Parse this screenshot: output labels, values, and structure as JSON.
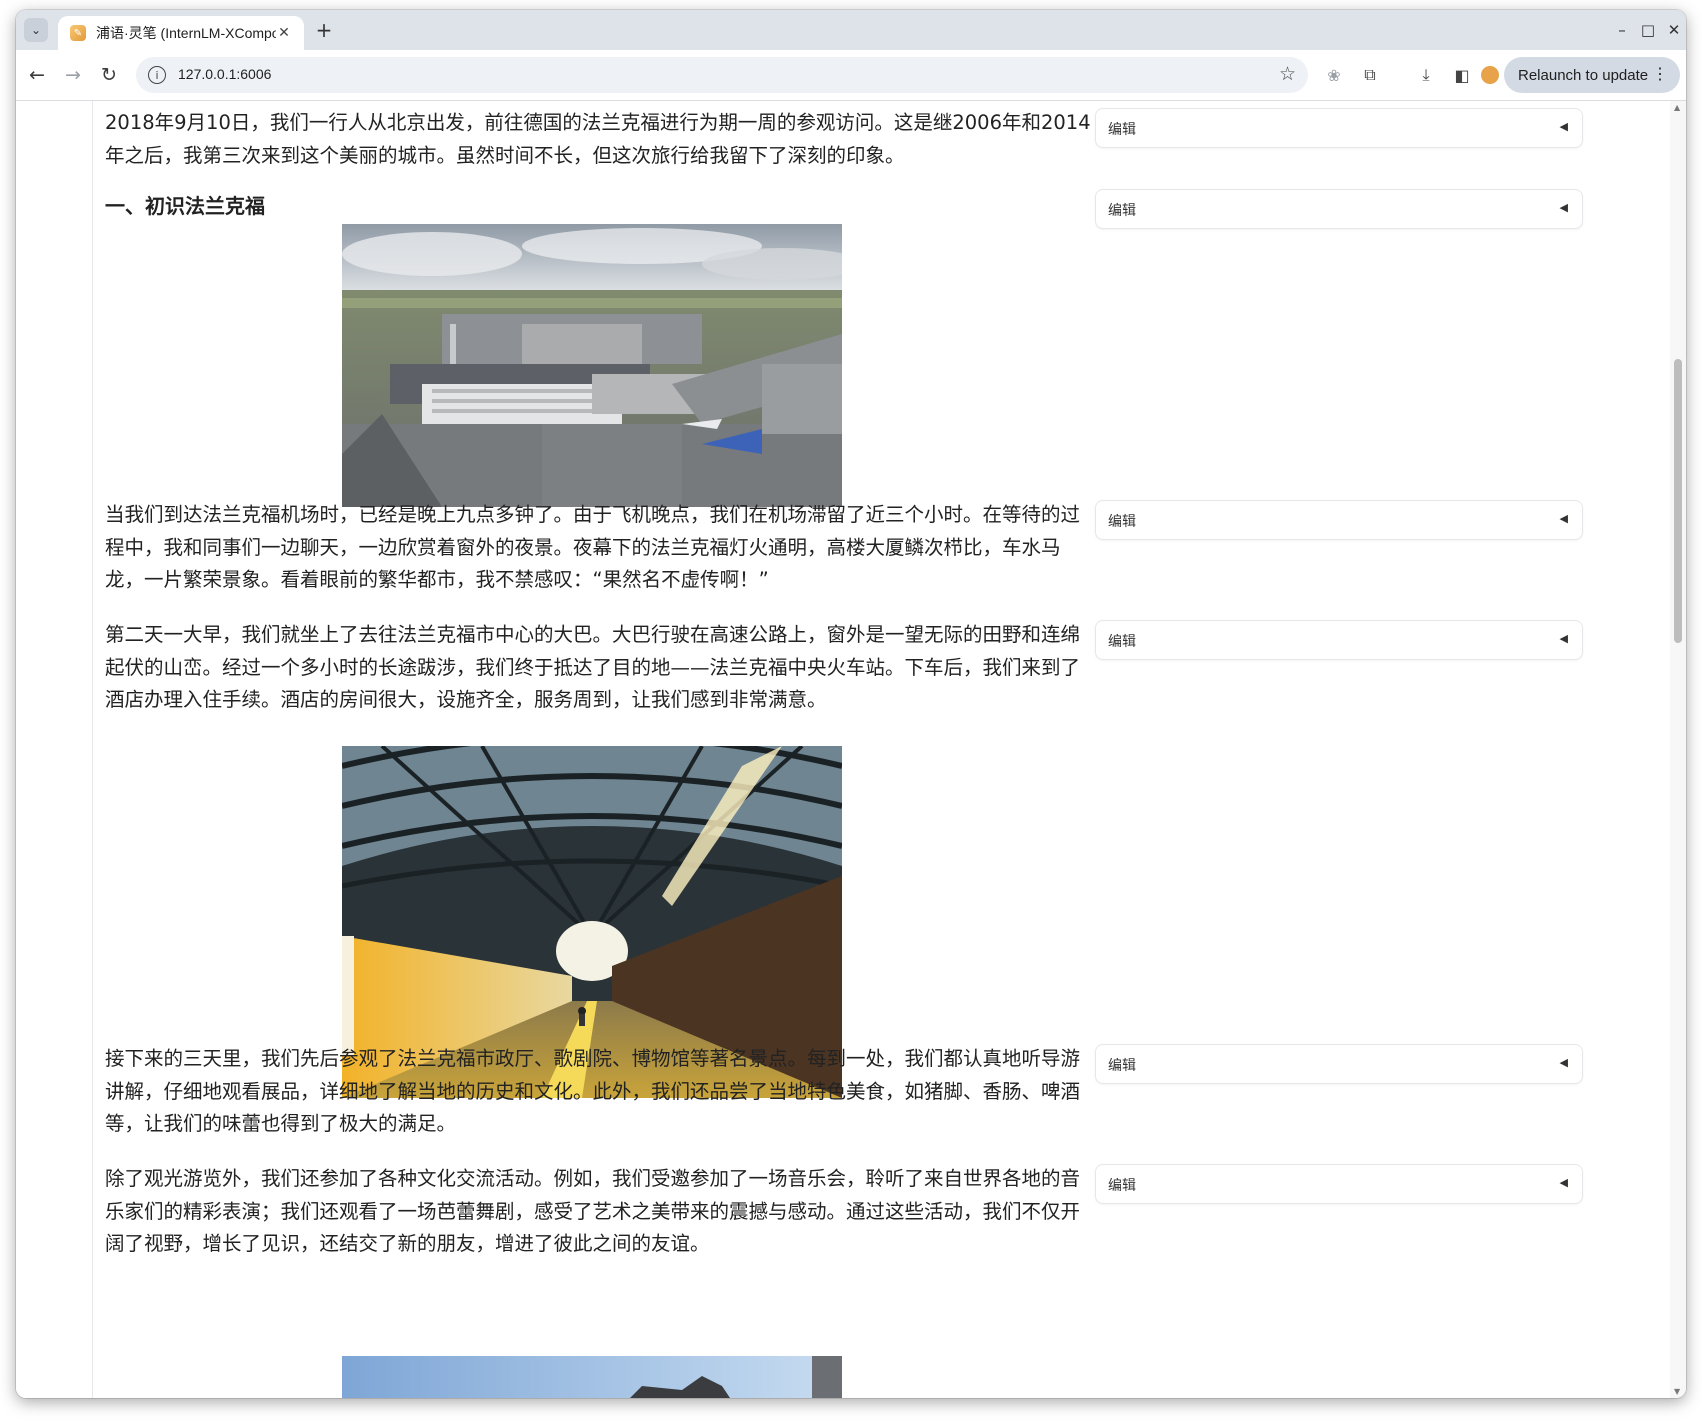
{
  "browser": {
    "tab_title": "浦语·灵笔 (InternLM-XComposer)",
    "url": "127.0.0.1:6006",
    "relaunch_label": "Relaunch to update"
  },
  "article": {
    "paragraphs": [
      "2018年9月10日，我们一行人从北京出发，前往德国的法兰克福进行为期一周的参观访问。这是继2006年和2014年之后，我第三次来到这个美丽的城市。虽然时间不长，但这次旅行给我留下了深刻的印象。",
      "当我们到达法兰克福机场时，已经是晚上九点多钟了。由于飞机晚点，我们在机场滞留了近三个小时。在等待的过程中，我和同事们一边聊天，一边欣赏着窗外的夜景。夜幕下的法兰克福灯火通明，高楼大厦鳞次栉比，车水马龙，一片繁荣景象。看着眼前的繁华都市，我不禁感叹：“果然名不虚传啊！”",
      "第二天一大早，我们就坐上了去往法兰克福市中心的大巴。大巴行驶在高速公路上，窗外是一望无际的田野和连绵起伏的山峦。经过一个多小时的长途跋涉，我们终于抵达了目的地——法兰克福中央火车站。下车后，我们来到了酒店办理入住手续。酒店的房间很大，设施齐全，服务周到，让我们感到非常满意。",
      "接下来的三天里，我们先后参观了法兰克福市政厅、歌剧院、博物馆等著名景点。每到一处，我们都认真地听导游讲解，仔细地观看展品，详细地了解当地的历史和文化。此外，我们还品尝了当地特色美食，如猪脚、香肠、啤酒等，让我们的味蕾也得到了极大的满足。",
      "除了观光游览外，我们还参加了各种文化交流活动。例如，我们受邀参加了一场音乐会，聆听了来自世界各地的音乐家们的精彩表演；我们还观看了一场芭蕾舞剧，感受了艺术之美带来的震撼与感动。通过这些活动，我们不仅开阔了视野，增长了见识，还结交了新的朋友，增进了彼此之间的友谊。"
    ],
    "heading": "一、初识法兰克福"
  },
  "edit_panel": {
    "label": "编辑"
  },
  "icons": {
    "tab_search": "chevron-down-icon",
    "favicon": "app-favicon-icon",
    "close": "close-icon",
    "new_tab": "plus-icon",
    "back": "arrow-left-icon",
    "forward": "arrow-right-icon",
    "reload": "reload-icon",
    "star": "star-icon",
    "download": "download-icon",
    "extensions": "puzzle-icon",
    "side_panel": "side-panel-icon",
    "profile": "profile-avatar-icon",
    "edit_caret": "caret-left-icon"
  }
}
